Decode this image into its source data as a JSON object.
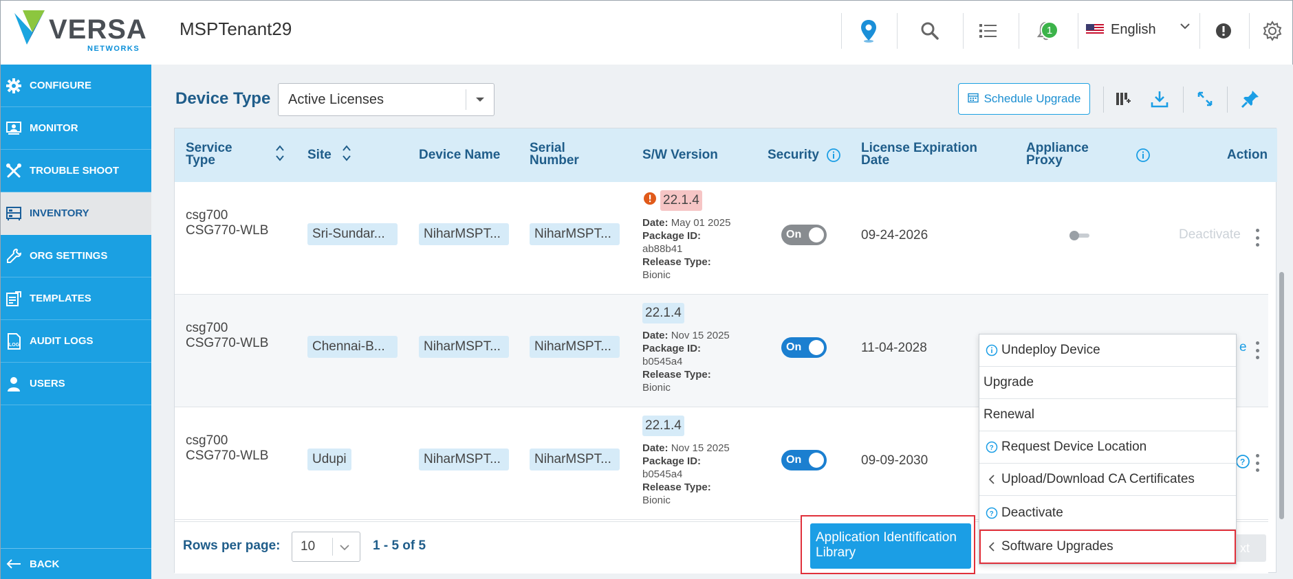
{
  "header": {
    "logo_word": "VERSA",
    "logo_sub": "NETWORKS",
    "tenant": "MSPTenant29",
    "notification_count": "1",
    "language": "English"
  },
  "sidebar": {
    "items": [
      {
        "label": "CONFIGURE",
        "icon": "gear-icon"
      },
      {
        "label": "MONITOR",
        "icon": "monitor-icon"
      },
      {
        "label": "TROUBLE SHOOT",
        "icon": "tools-icon"
      },
      {
        "label": "INVENTORY",
        "icon": "inventory-icon"
      },
      {
        "label": "ORG SETTINGS",
        "icon": "wrench-icon"
      },
      {
        "label": "TEMPLATES",
        "icon": "templates-icon"
      },
      {
        "label": "AUDIT LOGS",
        "icon": "log-icon"
      },
      {
        "label": "USERS",
        "icon": "user-icon"
      }
    ],
    "back_label": "BACK"
  },
  "toolbar": {
    "device_type_label": "Device Type",
    "device_type_value": "Active Licenses",
    "schedule_upgrade_label": "Schedule Upgrade"
  },
  "table": {
    "columns": {
      "service_type": "Service\nType",
      "site": "Site",
      "device_name": "Device Name",
      "serial_number": "Serial\nNumber",
      "sw_version": "S/W Version",
      "security": "Security",
      "license_expiration": "License Expiration\nDate",
      "appliance_proxy": "Appliance\nProxy",
      "action": "Action"
    },
    "meta_labels": {
      "date": "Date:",
      "package_id": "Package ID:",
      "release_type": "Release Type:"
    },
    "rows": [
      {
        "service_line1": "csg700",
        "service_line2": "CSG770-WLB",
        "site": "Sri-Sundar...",
        "device_name": "NiharMSPT...",
        "serial": "NiharMSPT...",
        "version": "22.1.4",
        "date": "May 01 2025",
        "package_id": "ab88b41",
        "release_type": "Bionic",
        "security": "On",
        "expiration": "09-24-2026",
        "action": "Deactivate"
      },
      {
        "service_line1": "csg700",
        "service_line2": "CSG770-WLB",
        "site": "Chennai-B...",
        "device_name": "NiharMSPT...",
        "serial": "NiharMSPT...",
        "version": "22.1.4",
        "date": "Nov 15 2025",
        "package_id": "b0545a4",
        "release_type": "Bionic",
        "security": "On",
        "expiration": "11-04-2028",
        "action": "e"
      },
      {
        "service_line1": "csg700",
        "service_line2": "CSG770-WLB",
        "site": "Udupi",
        "device_name": "NiharMSPT...",
        "serial": "NiharMSPT...",
        "version": "22.1.4",
        "date": "Nov 15 2025",
        "package_id": "b0545a4",
        "release_type": "Bionic",
        "security": "On",
        "expiration": "09-09-2030",
        "action": ""
      }
    ]
  },
  "footer": {
    "rows_per_page_label": "Rows per page:",
    "rows_per_page_value": "10",
    "range": "1 - 5 of 5",
    "next_label": "xt"
  },
  "context_menu": {
    "items": [
      {
        "label": "Undeploy Device",
        "icon": "info-icon"
      },
      {
        "label": "Upgrade",
        "icon": ""
      },
      {
        "label": "Renewal",
        "icon": ""
      },
      {
        "label": "Request Device Location",
        "icon": "help-icon"
      },
      {
        "label": "Upload/Download CA Certificates",
        "icon": "chevron-left-icon"
      },
      {
        "label": "Deactivate",
        "icon": "help-icon"
      },
      {
        "label": "Software Upgrades",
        "icon": "chevron-left-icon"
      }
    ],
    "submenu_item": "Application Identification Library"
  },
  "colors": {
    "sidebar": "#1ba0e2",
    "header_row": "#d7ecf8",
    "accent": "#1b7fd0",
    "warning": "#e05a1a",
    "highlight_border": "#e0303a"
  }
}
